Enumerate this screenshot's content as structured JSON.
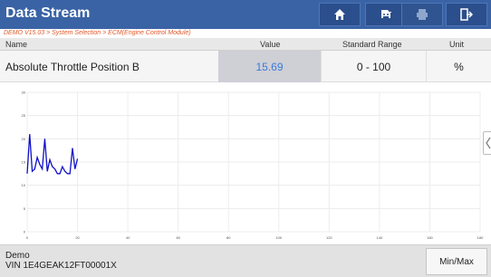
{
  "header": {
    "title": "Data Stream",
    "buttons": [
      {
        "icon": "home-icon"
      },
      {
        "icon": "car-icon"
      },
      {
        "icon": "print-icon",
        "disabled": true
      },
      {
        "icon": "exit-icon"
      }
    ]
  },
  "breadcrumb": "DEMO V15.03 > System Selection > ECM(Engine Control Module)",
  "table": {
    "columns": [
      "Name",
      "Value",
      "Standard Range",
      "Unit"
    ],
    "rows": [
      {
        "name": "Absolute Throttle Position B",
        "value": "15.69",
        "range": "0 - 100",
        "unit": "%"
      }
    ]
  },
  "chart_data": {
    "type": "line",
    "x": [
      0,
      1,
      2,
      3,
      4,
      5,
      6,
      7,
      8,
      9,
      10,
      11,
      12,
      13,
      14,
      15,
      16,
      17,
      18,
      19,
      20
    ],
    "series": [
      {
        "values": [
          12.5,
          21,
          13,
          13.5,
          16,
          14.5,
          13.5,
          20,
          13,
          15.5,
          14,
          13.5,
          12.5,
          12.5,
          14,
          13,
          12.5,
          12.5,
          18,
          13.5,
          15.7
        ]
      }
    ],
    "xlim": [
      0,
      180
    ],
    "ylim": [
      0,
      30
    ],
    "xticks": [
      0,
      20,
      40,
      60,
      80,
      100,
      120,
      140,
      160,
      180
    ],
    "yticks": [
      0,
      5,
      10,
      15,
      20,
      25,
      30
    ],
    "grid": true,
    "line_color": "#1010c8"
  },
  "footer": {
    "demo": "Demo",
    "vin": "VIN 1E4GEAK12FT00001X",
    "minmax_label": "Min/Max"
  },
  "colors": {
    "header_bg": "#3a63a5",
    "breadcrumb": "#e0592a",
    "value_text": "#3a7bd5"
  }
}
